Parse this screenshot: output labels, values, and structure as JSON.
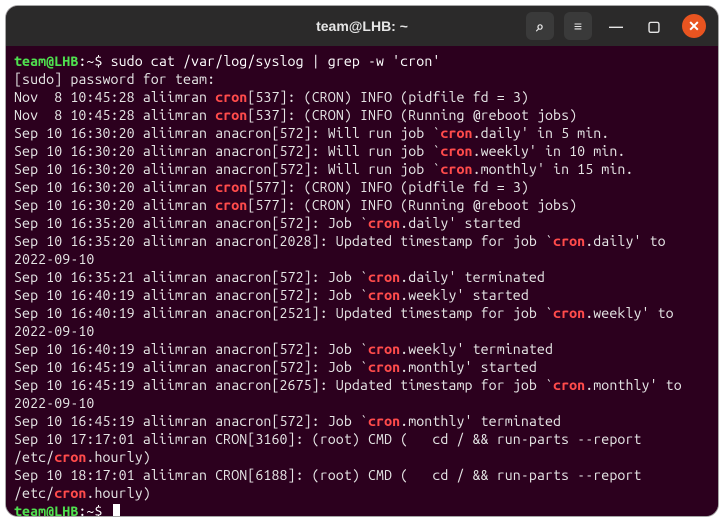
{
  "titlebar": {
    "title": "team@LHB: ~"
  },
  "icons": {
    "search": "⌕",
    "menu": "≡",
    "minimize": "—",
    "maximize": "▢",
    "close": "✕"
  },
  "prompt": {
    "userhost": "team@LHB",
    "path": "~",
    "dollar": "$"
  },
  "command": "sudo cat /var/log/syslog | grep -w 'cron'",
  "sudo_line": "[sudo] password for team:",
  "hl": "cron",
  "lines": [
    {
      "pre": "Nov  8 10:45:28 aliimran ",
      "hl": "cron",
      "post": "[537]: (CRON) INFO (pidfile fd = 3)"
    },
    {
      "pre": "Nov  8 10:45:28 aliimran ",
      "hl": "cron",
      "post": "[537]: (CRON) INFO (Running @reboot jobs)"
    },
    {
      "pre": "Sep 10 16:30:20 aliimran anacron[572]: Will run job `",
      "hl": "cron",
      "post": ".daily' in 5 min."
    },
    {
      "pre": "Sep 10 16:30:20 aliimran anacron[572]: Will run job `",
      "hl": "cron",
      "post": ".weekly' in 10 min."
    },
    {
      "pre": "Sep 10 16:30:20 aliimran anacron[572]: Will run job `",
      "hl": "cron",
      "post": ".monthly' in 15 min."
    },
    {
      "pre": "Sep 10 16:30:20 aliimran ",
      "hl": "cron",
      "post": "[577]: (CRON) INFO (pidfile fd = 3)"
    },
    {
      "pre": "Sep 10 16:30:20 aliimran ",
      "hl": "cron",
      "post": "[577]: (CRON) INFO (Running @reboot jobs)"
    },
    {
      "pre": "Sep 10 16:35:20 aliimran anacron[572]: Job `",
      "hl": "cron",
      "post": ".daily' started"
    },
    {
      "pre": "Sep 10 16:35:20 aliimran anacron[2028]: Updated timestamp for job `",
      "hl": "cron",
      "post": ".daily' to 2022-09-10"
    },
    {
      "pre": "Sep 10 16:35:21 aliimran anacron[572]: Job `",
      "hl": "cron",
      "post": ".daily' terminated"
    },
    {
      "pre": "Sep 10 16:40:19 aliimran anacron[572]: Job `",
      "hl": "cron",
      "post": ".weekly' started"
    },
    {
      "pre": "Sep 10 16:40:19 aliimran anacron[2521]: Updated timestamp for job `",
      "hl": "cron",
      "post": ".weekly' to 2022-09-10"
    },
    {
      "pre": "Sep 10 16:40:19 aliimran anacron[572]: Job `",
      "hl": "cron",
      "post": ".weekly' terminated"
    },
    {
      "pre": "Sep 10 16:45:19 aliimran anacron[572]: Job `",
      "hl": "cron",
      "post": ".monthly' started"
    },
    {
      "pre": "Sep 10 16:45:19 aliimran anacron[2675]: Updated timestamp for job `",
      "hl": "cron",
      "post": ".monthly' to 2022-09-10"
    },
    {
      "pre": "Sep 10 16:45:19 aliimran anacron[572]: Job `",
      "hl": "cron",
      "post": ".monthly' terminated"
    },
    {
      "pre": "Sep 10 17:17:01 aliimran CRON[3160]: (root) CMD (   cd / && run-parts --report /etc/",
      "hl": "cron",
      "post": ".hourly)"
    },
    {
      "pre": "Sep 10 18:17:01 aliimran CRON[6188]: (root) CMD (   cd / && run-parts --report /etc/",
      "hl": "cron",
      "post": ".hourly)"
    }
  ]
}
